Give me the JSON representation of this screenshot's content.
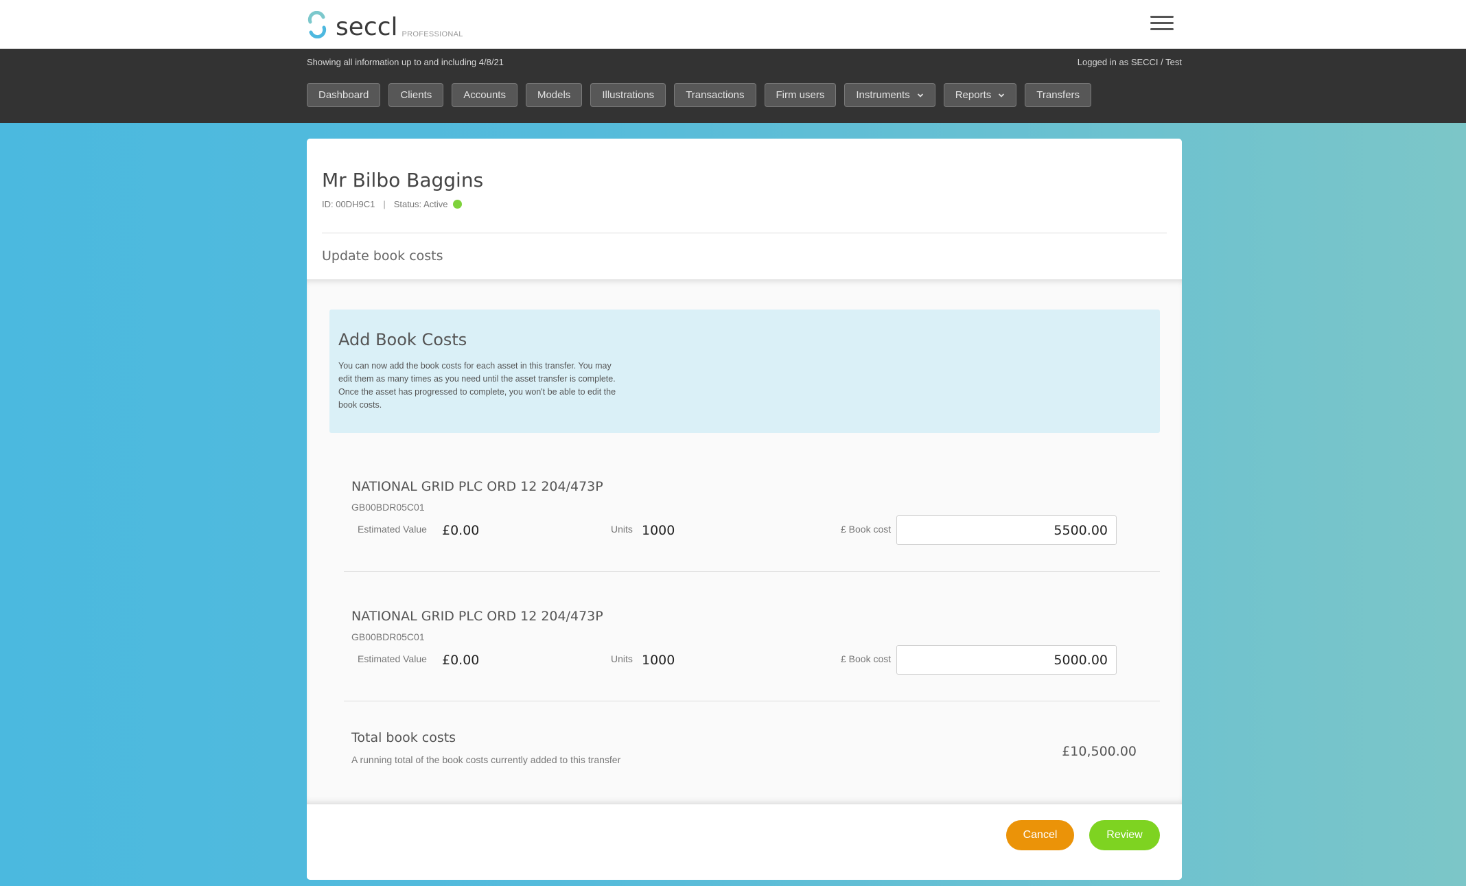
{
  "header": {
    "logo_text": "seccl",
    "logo_subtext": "PROFESSIONAL",
    "menu_icon": "hamburger-menu-icon"
  },
  "infobar": {
    "date_info": "Showing all information up to and including 4/8/21",
    "logged_in": "Logged in as SECCI / Test"
  },
  "nav": {
    "items": [
      {
        "label": "Dashboard",
        "dropdown": false
      },
      {
        "label": "Clients",
        "dropdown": false
      },
      {
        "label": "Accounts",
        "dropdown": false
      },
      {
        "label": "Models",
        "dropdown": false
      },
      {
        "label": "Illustrations",
        "dropdown": false
      },
      {
        "label": "Transactions",
        "dropdown": false
      },
      {
        "label": "Firm users",
        "dropdown": false
      },
      {
        "label": "Instruments",
        "dropdown": true
      },
      {
        "label": "Reports",
        "dropdown": true
      },
      {
        "label": "Transfers",
        "dropdown": false
      }
    ]
  },
  "client": {
    "name": "Mr Bilbo Baggins",
    "id_text": "ID: 00DH9C1",
    "separator": "|",
    "status_text": "Status: Active",
    "status_color": "#7ed23b"
  },
  "page": {
    "subtitle": "Update book costs"
  },
  "infobox": {
    "title": "Add Book Costs",
    "text": "You can now add the book costs for each asset in this transfer. You may edit them as many times as you need until the asset transfer is complete. Once the asset has progressed to complete, you won't be able to edit the book costs."
  },
  "assets": [
    {
      "name": "NATIONAL GRID PLC ORD 12 204/473P",
      "isin": "GB00BDR05C01",
      "estimated_value_label": "Estimated Value",
      "estimated_value": "£0.00",
      "units_label": "Units",
      "units": "1000",
      "book_cost_label": "£ Book cost",
      "book_cost": "5500.00"
    },
    {
      "name": "NATIONAL GRID PLC ORD 12 204/473P",
      "isin": "GB00BDR05C01",
      "estimated_value_label": "Estimated Value",
      "estimated_value": "£0.00",
      "units_label": "Units",
      "units": "1000",
      "book_cost_label": "£ Book cost",
      "book_cost": "5000.00"
    }
  ],
  "total": {
    "title": "Total book costs",
    "subtitle": "A running total of the book costs currently added to this transfer",
    "amount": "£10,500.00"
  },
  "actions": {
    "cancel_label": "Cancel",
    "review_label": "Review",
    "cancel_color": "#eb9308",
    "review_color": "#7ed321"
  }
}
